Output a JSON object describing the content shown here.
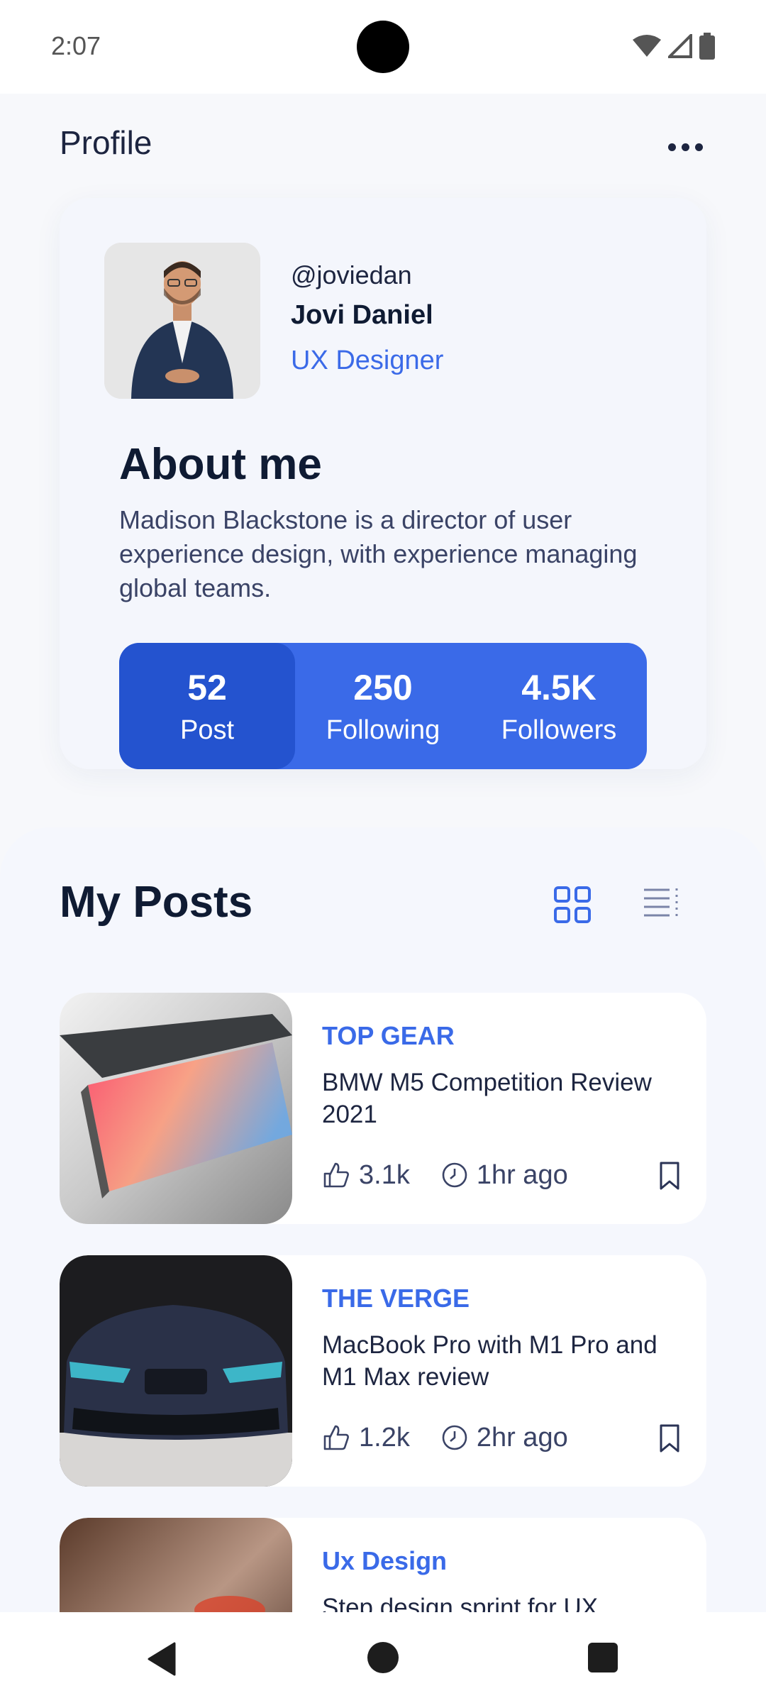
{
  "status_bar": {
    "time": "2:07"
  },
  "header": {
    "title": "Profile"
  },
  "profile": {
    "handle": "@joviedan",
    "name": "Jovi Daniel",
    "role": "UX Designer",
    "about_title": "About me",
    "about_text": "Madison Blackstone is a director of user experience design, with experience managing global teams.",
    "stats": [
      {
        "value": "52",
        "label": "Post"
      },
      {
        "value": "250",
        "label": "Following"
      },
      {
        "value": "4.5K",
        "label": "Followers"
      }
    ]
  },
  "posts": {
    "title": "My Posts",
    "items": [
      {
        "source": "TOP GEAR",
        "title": "BMW M5 Competition Review 2021",
        "likes": "3.1k",
        "time": "1hr ago"
      },
      {
        "source": "THE VERGE",
        "title": "MacBook Pro with M1 Pro and M1 Max review",
        "likes": "1.2k",
        "time": "2hr ago"
      },
      {
        "source": "Ux Design",
        "title": "Step design sprint for UX",
        "likes": "",
        "time": ""
      }
    ]
  },
  "colors": {
    "accent": "#3a6ae8",
    "accent_dark": "#2453cf",
    "text_dark": "#0f1b33"
  }
}
